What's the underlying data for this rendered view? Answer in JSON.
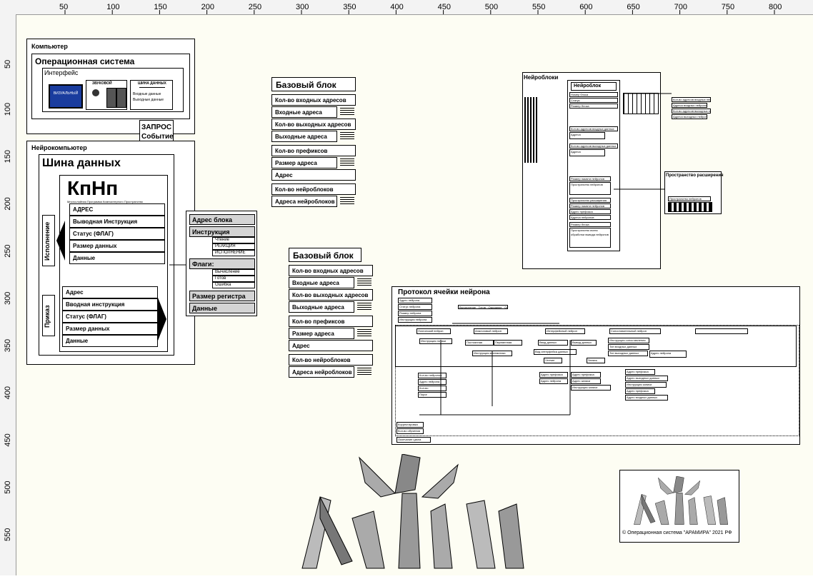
{
  "rulers": {
    "top_ticks": [
      "50",
      "100",
      "150",
      "200",
      "250",
      "300",
      "350",
      "400",
      "450",
      "500",
      "550",
      "600",
      "650",
      "700",
      "750",
      "800"
    ],
    "left_ticks": [
      "50",
      "100",
      "150",
      "200",
      "250",
      "300",
      "350",
      "400",
      "450",
      "500",
      "550"
    ]
  },
  "computer": {
    "title": "Компьютер",
    "os_title": "Операционная система",
    "interface_label": "Интерфейс",
    "visual_label": "ВИЗУАЛЬНЫЙ",
    "sound_label": "ЗВУКОВОЙ",
    "bus_title": "ШИНА ДАННЫХ",
    "bus_in": "Входные данные",
    "bus_out": "Выходные данные"
  },
  "request": {
    "line1": "ЗАПРОС",
    "line2": "Событие"
  },
  "neurocomputer": {
    "title": "Нейрокомпьютер",
    "bus_title": "Шина данных",
    "logo": "КпНп",
    "logo_sub": "Многослойная Программа Компьютерного Пространства",
    "exec_label": "Исполнение",
    "exec_rows": [
      "АДРЕС",
      "Выводная Инструкция",
      "Статус (ФЛАГ)",
      "Размер данных",
      "Данные"
    ],
    "order_label": "Приказ",
    "order_rows": [
      "Адрес",
      "Вводная инструкция",
      "Статус (ФЛАГ)",
      "Размер данных",
      "Данные"
    ]
  },
  "block_panel": {
    "address": "Адрес блока",
    "instruction": "Инструкция",
    "instr_items": [
      "Чтение",
      "РЕАКЦИЯ",
      "ИСПОЛНЕНИЕ"
    ],
    "flags": "Флаги:",
    "flag_items": [
      "Вычисление",
      "Готов",
      "Ошибка"
    ],
    "reg_size": "Размер регистра",
    "data": "Данные"
  },
  "base_block_1": {
    "title": "Базовый блок",
    "rows": [
      "Кол-во входных адресов",
      "Входные адреса",
      "Кол-во выходных адресов",
      "Выходные адреса",
      "Кол-во префиксов",
      "Размер адреса",
      "Адрес",
      "Кол-во нейроблоков",
      "Адреса нейроблоков"
    ]
  },
  "base_block_2": {
    "title": "Базовый блок",
    "rows": [
      "Кол-во входных адресов",
      "Входные адреса",
      "Кол-во выходных адресов",
      "Выходные адреса",
      "Кол-во префиксов",
      "Размер адреса",
      "Адрес",
      "Кол-во нейроблоков",
      "Адреса нейроблоков"
    ]
  },
  "neuroblocks": {
    "title": "Нейроблоки",
    "neuroblock_title": "Нейроблок",
    "rows_top": [
      "Номер блока",
      "Статус",
      "Размер блока"
    ],
    "in_count": "Кол-во адресов входных данных",
    "in_addr": "Адреса",
    "out_count": "Кол-во адресов выходных данных",
    "out_addr": "Адреса",
    "rows_mid": [
      "Размер памяти нейронов",
      "Пространство нейронов"
    ],
    "rows_bot": [
      "Пространство расширения",
      "Размер памяти нейронов",
      "Адрес префикса",
      "Адреса нейронов",
      "Размер блока",
      "Пространство ячеек обработки вывода нейронов"
    ],
    "side_labels": [
      "Кол-во адресов входных нейронов",
      "Адреса входных нейронов",
      "Кол-во адресов выходных нейронов",
      "Адреса выходных нейронов"
    ],
    "expansion_title": "Пространство расширения",
    "expansion_row": "Пространство нейронов"
  },
  "protocol": {
    "title": "Протокол ячейки нейрона",
    "header_rows": [
      "Адрес нейрона",
      "Статус нейрона",
      "Размер нейрона",
      "Инструкция нейрона"
    ],
    "status_row": "Вычисление · Готов · Ожидание · Ошибка · Данные",
    "types": [
      "Логический нейрон",
      "Аналоговый нейрон",
      "Интерфейсный нейрон",
      "Сопоставительный нейрон"
    ],
    "logic_items": [
      "Инструкция логики",
      "Кол-во нейронов",
      "Адрес нейрона",
      "Кол-во",
      "Порог"
    ],
    "analog_items": [
      "Постоянная",
      "Переменная",
      "Инструкция математики"
    ],
    "iface_items": [
      "Ввод данных",
      "Вывод данных",
      "Вид интерфейса данных",
      "Чтение",
      "Запись",
      "Адрес префикса",
      "Адрес нейрона",
      "Адрес префикса",
      "Адрес записи",
      "Инструкция записи"
    ],
    "compare_items": [
      "Инструкция сопоставления",
      "Тип входных данных",
      "Тип выходных данных",
      "Адрес нейрона"
    ],
    "right_items": [
      "Адрес префикса",
      "Адрес выходных данных",
      "Инструкция записи",
      "Адрес префикса",
      "Адрес входных данных"
    ],
    "footer_rows": [
      "Корректировка",
      "Кол-во обучения",
      "Окончание цикла"
    ]
  },
  "copyright": "© Операционная система \"АРАМИРА\" 2021 РФ"
}
